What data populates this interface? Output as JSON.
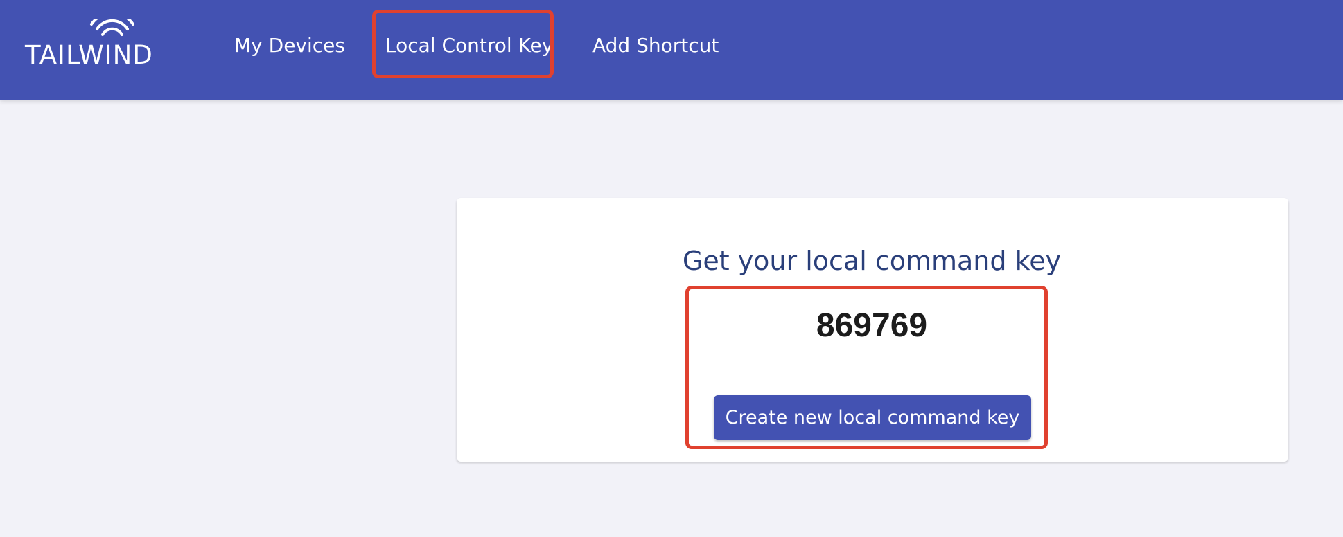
{
  "brand": {
    "logo_text": "TAILWIND",
    "wifi_icon": "wifi-icon"
  },
  "nav": {
    "items": [
      {
        "label": "My Devices"
      },
      {
        "label": "Local Control Key"
      },
      {
        "label": "Add Shortcut"
      }
    ],
    "active_index": 1
  },
  "card": {
    "title": "Get your local command key",
    "key_value": "869769",
    "create_button_label": "Create new local command key"
  },
  "colors": {
    "navbar": "#4352b2",
    "button": "#4352b2",
    "title": "#2a3f7a",
    "highlight": "#e0412f",
    "background": "#f2f2f8"
  }
}
